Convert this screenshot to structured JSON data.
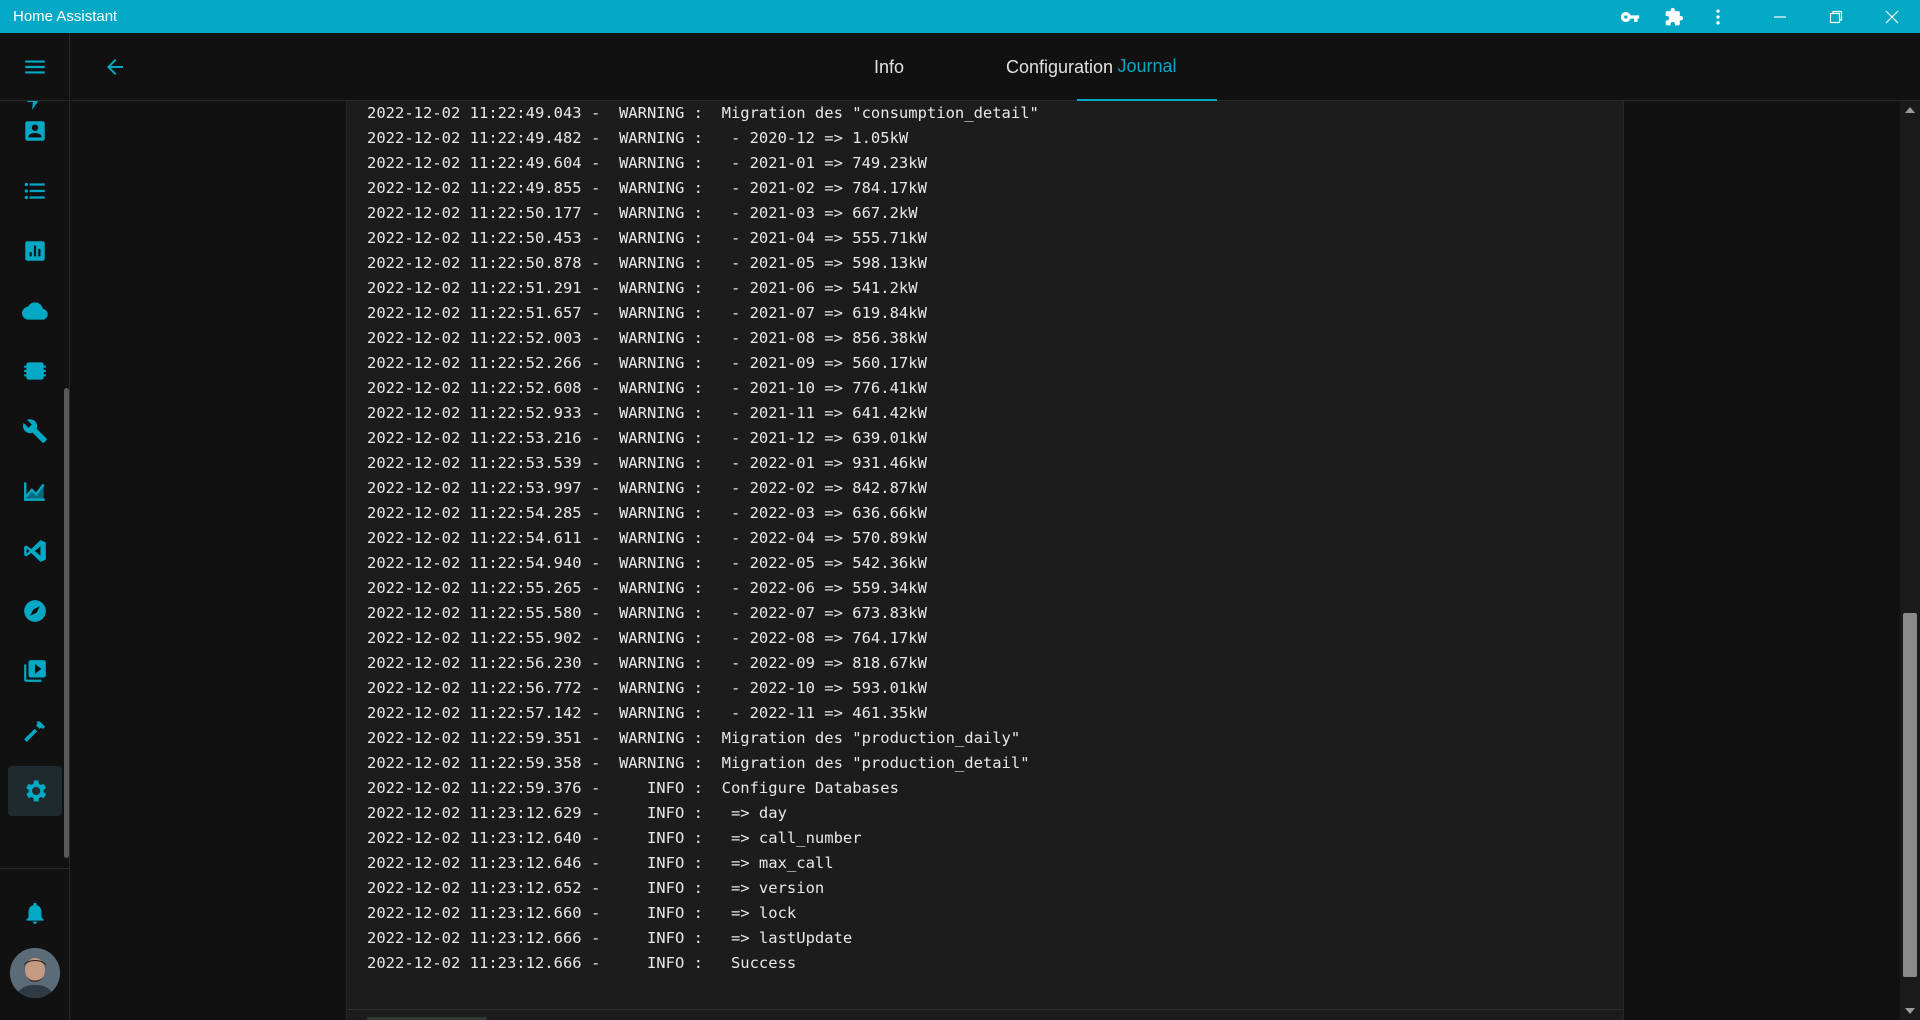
{
  "window": {
    "title": "Home Assistant",
    "icons": [
      "key-icon",
      "puzzle-icon",
      "more-vert-icon"
    ],
    "controls": [
      "minimize-icon",
      "restore-icon",
      "close-icon"
    ]
  },
  "colors": {
    "accent": "#03a9c4",
    "background": "#111111",
    "log_background": "#1c1c1c",
    "text": "#e1e1e1"
  },
  "sidebar": {
    "items": [
      {
        "icon": "partial-top-icon"
      },
      {
        "icon": "account-box-icon"
      },
      {
        "icon": "format-list-bulleted-icon"
      },
      {
        "icon": "chart-box-icon"
      },
      {
        "icon": "cloud-icon"
      },
      {
        "icon": "chip-icon"
      },
      {
        "icon": "wrench-icon"
      },
      {
        "icon": "chart-areaspline-icon"
      },
      {
        "icon": "vscode-icon"
      },
      {
        "icon": "compass-icon"
      },
      {
        "icon": "play-box-multiple-icon"
      },
      {
        "icon": "hammer-icon"
      },
      {
        "icon": "cog-icon",
        "active": true
      }
    ],
    "bottom": [
      {
        "icon": "bell-icon"
      },
      {
        "icon": "avatar"
      }
    ]
  },
  "header": {
    "back_icon": "arrow-left-icon",
    "tabs": [
      {
        "label": "Info"
      },
      {
        "label": "Configuration"
      },
      {
        "label": "Journal",
        "active": true
      }
    ]
  },
  "log": {
    "lines": [
      "2022-12-02 11:22:49.043 -  WARNING :  Migration des \"consumption_detail\"",
      "2022-12-02 11:22:49.482 -  WARNING :   - 2020-12 => 1.05kW",
      "2022-12-02 11:22:49.604 -  WARNING :   - 2021-01 => 749.23kW",
      "2022-12-02 11:22:49.855 -  WARNING :   - 2021-02 => 784.17kW",
      "2022-12-02 11:22:50.177 -  WARNING :   - 2021-03 => 667.2kW",
      "2022-12-02 11:22:50.453 -  WARNING :   - 2021-04 => 555.71kW",
      "2022-12-02 11:22:50.878 -  WARNING :   - 2021-05 => 598.13kW",
      "2022-12-02 11:22:51.291 -  WARNING :   - 2021-06 => 541.2kW",
      "2022-12-02 11:22:51.657 -  WARNING :   - 2021-07 => 619.84kW",
      "2022-12-02 11:22:52.003 -  WARNING :   - 2021-08 => 856.38kW",
      "2022-12-02 11:22:52.266 -  WARNING :   - 2021-09 => 560.17kW",
      "2022-12-02 11:22:52.608 -  WARNING :   - 2021-10 => 776.41kW",
      "2022-12-02 11:22:52.933 -  WARNING :   - 2021-11 => 641.42kW",
      "2022-12-02 11:22:53.216 -  WARNING :   - 2021-12 => 639.01kW",
      "2022-12-02 11:22:53.539 -  WARNING :   - 2022-01 => 931.46kW",
      "2022-12-02 11:22:53.997 -  WARNING :   - 2022-02 => 842.87kW",
      "2022-12-02 11:22:54.285 -  WARNING :   - 2022-03 => 636.66kW",
      "2022-12-02 11:22:54.611 -  WARNING :   - 2022-04 => 570.89kW",
      "2022-12-02 11:22:54.940 -  WARNING :   - 2022-05 => 542.36kW",
      "2022-12-02 11:22:55.265 -  WARNING :   - 2022-06 => 559.34kW",
      "2022-12-02 11:22:55.580 -  WARNING :   - 2022-07 => 673.83kW",
      "2022-12-02 11:22:55.902 -  WARNING :   - 2022-08 => 764.17kW",
      "2022-12-02 11:22:56.230 -  WARNING :   - 2022-09 => 818.67kW",
      "2022-12-02 11:22:56.772 -  WARNING :   - 2022-10 => 593.01kW",
      "2022-12-02 11:22:57.142 -  WARNING :   - 2022-11 => 461.35kW",
      "2022-12-02 11:22:59.351 -  WARNING :  Migration des \"production_daily\"",
      "2022-12-02 11:22:59.358 -  WARNING :  Migration des \"production_detail\"",
      "2022-12-02 11:22:59.376 -     INFO :  Configure Databases",
      "2022-12-02 11:23:12.629 -     INFO :   => day",
      "2022-12-02 11:23:12.640 -     INFO :   => call_number",
      "2022-12-02 11:23:12.646 -     INFO :   => max_call",
      "2022-12-02 11:23:12.652 -     INFO :   => version",
      "2022-12-02 11:23:12.660 -     INFO :   => lock",
      "2022-12-02 11:23:12.666 -     INFO :   => lastUpdate",
      "2022-12-02 11:23:12.666 -     INFO :   Success"
    ]
  }
}
